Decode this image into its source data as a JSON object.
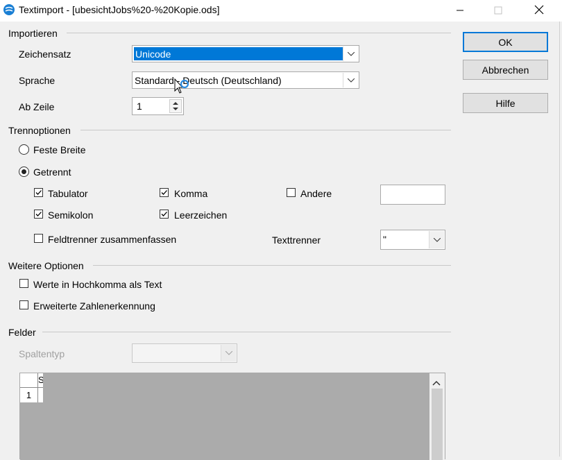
{
  "window": {
    "title": "Textimport - [ubesichtJobs%20-%20Kopie.ods]",
    "controls": [
      "minimize-icon",
      "maximize-icon",
      "close-icon"
    ]
  },
  "importieren": {
    "heading": "Importieren",
    "zeichensatz_label": "Zeichensatz",
    "zeichensatz_value": "Unicode",
    "sprache_label": "Sprache",
    "sprache_value": "Standard - Deutsch (Deutschland)",
    "ab_zeile_label": "Ab Zeile",
    "ab_zeile_value": "1"
  },
  "trennoptionen": {
    "heading": "Trennoptionen",
    "feste_breite": "Feste Breite",
    "getrennt": "Getrennt",
    "selected_mode": "Getrennt",
    "tabulator": "Tabulator",
    "komma": "Komma",
    "andere": "Andere",
    "andere_value": "",
    "semikolon": "Semikolon",
    "leerzeichen": "Leerzeichen",
    "feldtrenner": "Feldtrenner zusammenfassen",
    "texttrenner_label": "Texttrenner",
    "texttrenner_value": "\"",
    "checked": {
      "tabulator": true,
      "komma": true,
      "andere": false,
      "semikolon": true,
      "leerzeichen": true,
      "feldtrenner": false
    }
  },
  "weitere": {
    "heading": "Weitere Optionen",
    "hochkomma": "Werte in Hochkomma als Text",
    "zahlen": "Erweiterte Zahlenerkennung",
    "checked": {
      "hochkomma": false,
      "zahlen": false
    }
  },
  "felder": {
    "heading": "Felder",
    "spaltentyp_label": "Spaltentyp",
    "spaltentyp_value": "",
    "grid_col_header": "S",
    "grid_row_header": "1"
  },
  "buttons": {
    "ok": "OK",
    "abbrechen": "Abbrechen",
    "hilfe": "Hilfe"
  },
  "colors": {
    "selection": "#0078d7",
    "preview_gray": "#ababab",
    "background": "#f0f0f0"
  }
}
